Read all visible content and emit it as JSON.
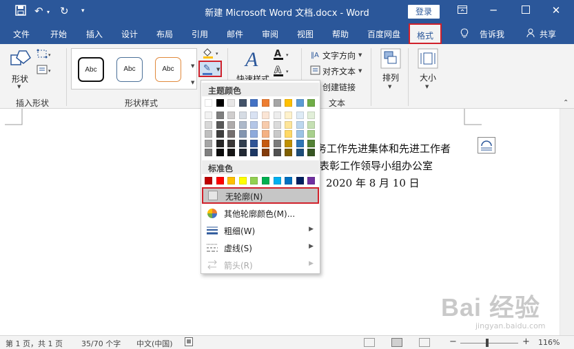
{
  "window": {
    "title": "新建 Microsoft Word 文档.docx  -  Word",
    "login": "登录",
    "icons": {
      "save": "save-icon",
      "undo": "undo-icon",
      "redo": "redo-icon",
      "qat": "customize-qat-icon"
    }
  },
  "menu": {
    "tabs": [
      "文件",
      "开始",
      "插入",
      "设计",
      "布局",
      "引用",
      "邮件",
      "审阅",
      "视图",
      "帮助",
      "百度网盘"
    ],
    "active_tab": "格式",
    "tell_me": "告诉我",
    "share": "共享"
  },
  "ribbon": {
    "insert_shapes": {
      "shapes_label": "形状",
      "group_label": "插入形状"
    },
    "shape_styles": {
      "samples": [
        "Abc",
        "Abc",
        "Abc"
      ],
      "group_label": "形状样式",
      "quick_styles": "快速样式"
    },
    "text": {
      "direction": "文字方向",
      "align": "对齐文本",
      "link": "创建链接",
      "group_label": "文本"
    },
    "arrange": "排列",
    "size": "大小"
  },
  "document": {
    "lines": [
      "务工作先进集体和先进工作者",
      "表彰工作领导小组办公室",
      "2020 年 8 月 10 日"
    ]
  },
  "outline_menu": {
    "theme_colors_label": "主题颜色",
    "standard_colors_label": "标准色",
    "theme_top_row": [
      "#ffffff",
      "#000000",
      "#e7e6e6",
      "#44546a",
      "#4472c4",
      "#ed7d31",
      "#a5a5a5",
      "#ffc000",
      "#5b9bd5",
      "#70ad47"
    ],
    "theme_shades": [
      [
        "#f2f2f2",
        "#7f7f7f",
        "#d0cece",
        "#d6dce4",
        "#d9e2f3",
        "#fbe5d5",
        "#ededed",
        "#fff2cc",
        "#deebf6",
        "#e2efd9"
      ],
      [
        "#d8d8d8",
        "#595959",
        "#aeabab",
        "#adb9ca",
        "#b4c6e7",
        "#f7cbac",
        "#dbdbdb",
        "#fee599",
        "#bdd7ee",
        "#c5e0b3"
      ],
      [
        "#bfbfbf",
        "#3f3f3f",
        "#757070",
        "#8496b0",
        "#8eaadb",
        "#f4b183",
        "#c9c9c9",
        "#ffd966",
        "#9cc3e5",
        "#a8d08d"
      ],
      [
        "#a5a5a5",
        "#262626",
        "#3a3838",
        "#323f4f",
        "#2f5496",
        "#c55a11",
        "#7b7b7b",
        "#bf9000",
        "#2e75b5",
        "#538135"
      ],
      [
        "#7f7f7f",
        "#0c0c0c",
        "#171616",
        "#222a35",
        "#1e3864",
        "#833c0b",
        "#525252",
        "#7f6000",
        "#1e4e79",
        "#375623"
      ]
    ],
    "standard_colors": [
      "#c00000",
      "#ff0000",
      "#ffc000",
      "#ffff00",
      "#92d050",
      "#00b050",
      "#00b0f0",
      "#0070c0",
      "#002060",
      "#7030a0"
    ],
    "items": {
      "no_outline": "无轮廓(N)",
      "more_colors": "其他轮廓颜色(M)...",
      "weight": "粗细(W)",
      "dashes": "虚线(S)",
      "arrows": "箭头(R)"
    }
  },
  "status": {
    "page": "第 1 页，共 1 页",
    "words": "35/70 个字",
    "language": "中文(中国)",
    "zoom": "116%",
    "zoom_minus": "−",
    "zoom_plus": "+"
  },
  "watermark": {
    "logo": "Bai 经验",
    "url": "jingyan.baidu.com"
  }
}
